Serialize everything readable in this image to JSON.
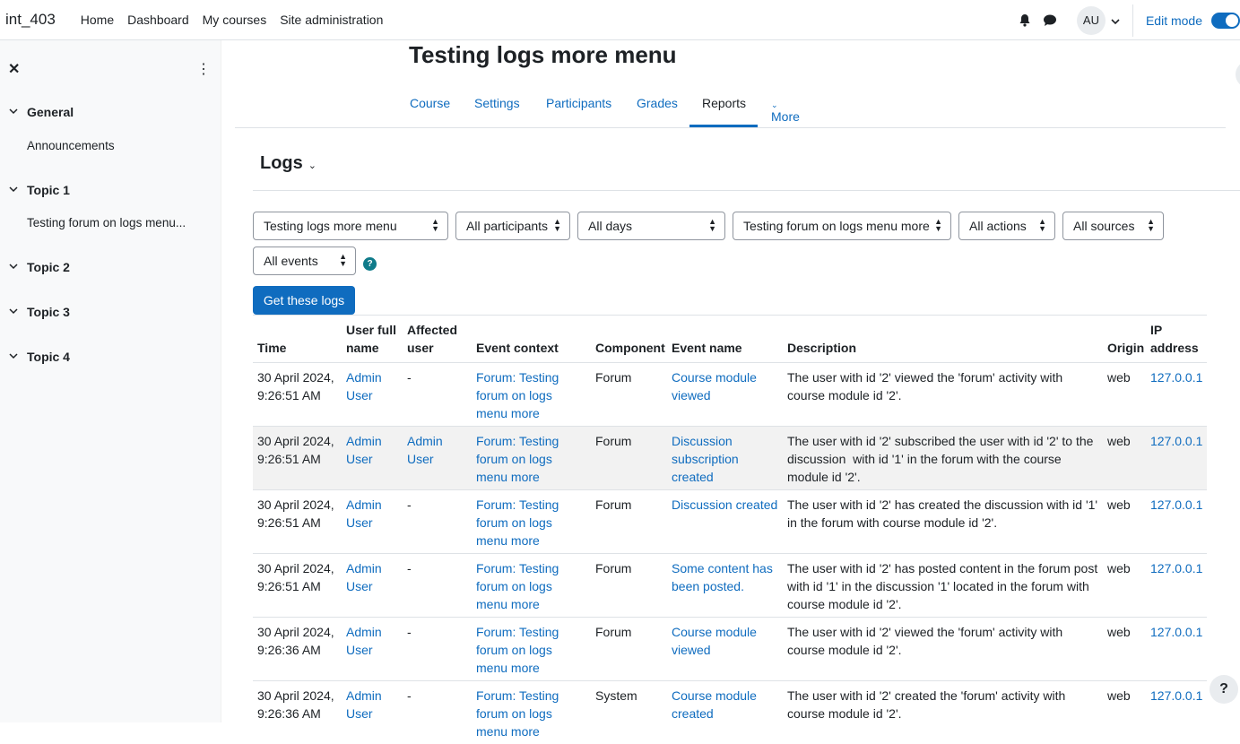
{
  "navbar": {
    "brand": "int_403",
    "links": [
      "Home",
      "Dashboard",
      "My courses",
      "Site administration"
    ],
    "avatar": "AU",
    "edit_mode": "Edit mode",
    "icons": [
      "bell-icon",
      "chat-icon",
      "chevron-down-icon"
    ]
  },
  "drawer": {
    "sections": [
      {
        "title": "General",
        "items": [
          "Announcements"
        ]
      },
      {
        "title": "Topic 1",
        "items": [
          "Testing forum on logs menu..."
        ]
      },
      {
        "title": "Topic 2",
        "items": []
      },
      {
        "title": "Topic 3",
        "items": []
      },
      {
        "title": "Topic 4",
        "items": []
      }
    ]
  },
  "page": {
    "title": "Testing logs more menu",
    "tabs": [
      "Course",
      "Settings",
      "Participants",
      "Grades",
      "Reports",
      "More"
    ],
    "active_tab": "Reports",
    "logs_heading": "Logs"
  },
  "filters": {
    "course": "Testing logs more menu",
    "participants": "All participants",
    "days": "All days",
    "activity": "Testing forum on logs menu more",
    "actions": "All actions",
    "sources": "All sources",
    "events": "All events",
    "submit": "Get these logs"
  },
  "table": {
    "headers": [
      "Time",
      "User full name",
      "Affected user",
      "Event context",
      "Component",
      "Event name",
      "Description",
      "Origin",
      "IP address"
    ],
    "rows": [
      {
        "time": "30 April 2024, 9:26:51 AM",
        "user": "Admin User",
        "affected": "-",
        "context": "Forum: Testing forum on logs menu more",
        "component": "Forum",
        "event": "Course module viewed",
        "description": "The user with id '2' viewed the 'forum' activity with course module id '2'.",
        "origin": "web",
        "ip": "127.0.0.1"
      },
      {
        "time": "30 April 2024, 9:26:51 AM",
        "user": "Admin User",
        "affected": "Admin User",
        "context": "Forum: Testing forum on logs menu more",
        "component": "Forum",
        "event": "Discussion subscription created",
        "description": "The user with id '2' subscribed the user with id '2' to the discussion  with id '1' in the forum with the course module id '2'.",
        "origin": "web",
        "ip": "127.0.0.1"
      },
      {
        "time": "30 April 2024, 9:26:51 AM",
        "user": "Admin User",
        "affected": "-",
        "context": "Forum: Testing forum on logs menu more",
        "component": "Forum",
        "event": "Discussion created",
        "description": "The user with id '2' has created the discussion with id '1' in the forum with course module id '2'.",
        "origin": "web",
        "ip": "127.0.0.1"
      },
      {
        "time": "30 April 2024, 9:26:51 AM",
        "user": "Admin User",
        "affected": "-",
        "context": "Forum: Testing forum on logs menu more",
        "component": "Forum",
        "event": "Some content has been posted.",
        "description": "The user with id '2' has posted content in the forum post with id '1' in the discussion '1' located in the forum with course module id '2'.",
        "origin": "web",
        "ip": "127.0.0.1"
      },
      {
        "time": "30 April 2024, 9:26:36 AM",
        "user": "Admin User",
        "affected": "-",
        "context": "Forum: Testing forum on logs menu more",
        "component": "Forum",
        "event": "Course module viewed",
        "description": "The user with id '2' viewed the 'forum' activity with course module id '2'.",
        "origin": "web",
        "ip": "127.0.0.1"
      },
      {
        "time": "30 April 2024, 9:26:36 AM",
        "user": "Admin User",
        "affected": "-",
        "context": "Forum: Testing forum on logs menu more",
        "component": "System",
        "event": "Course module created",
        "description": "The user with id '2' created the 'forum' activity with course module id '2'.",
        "origin": "web",
        "ip": "127.0.0.1"
      }
    ]
  },
  "help_button": "?"
}
